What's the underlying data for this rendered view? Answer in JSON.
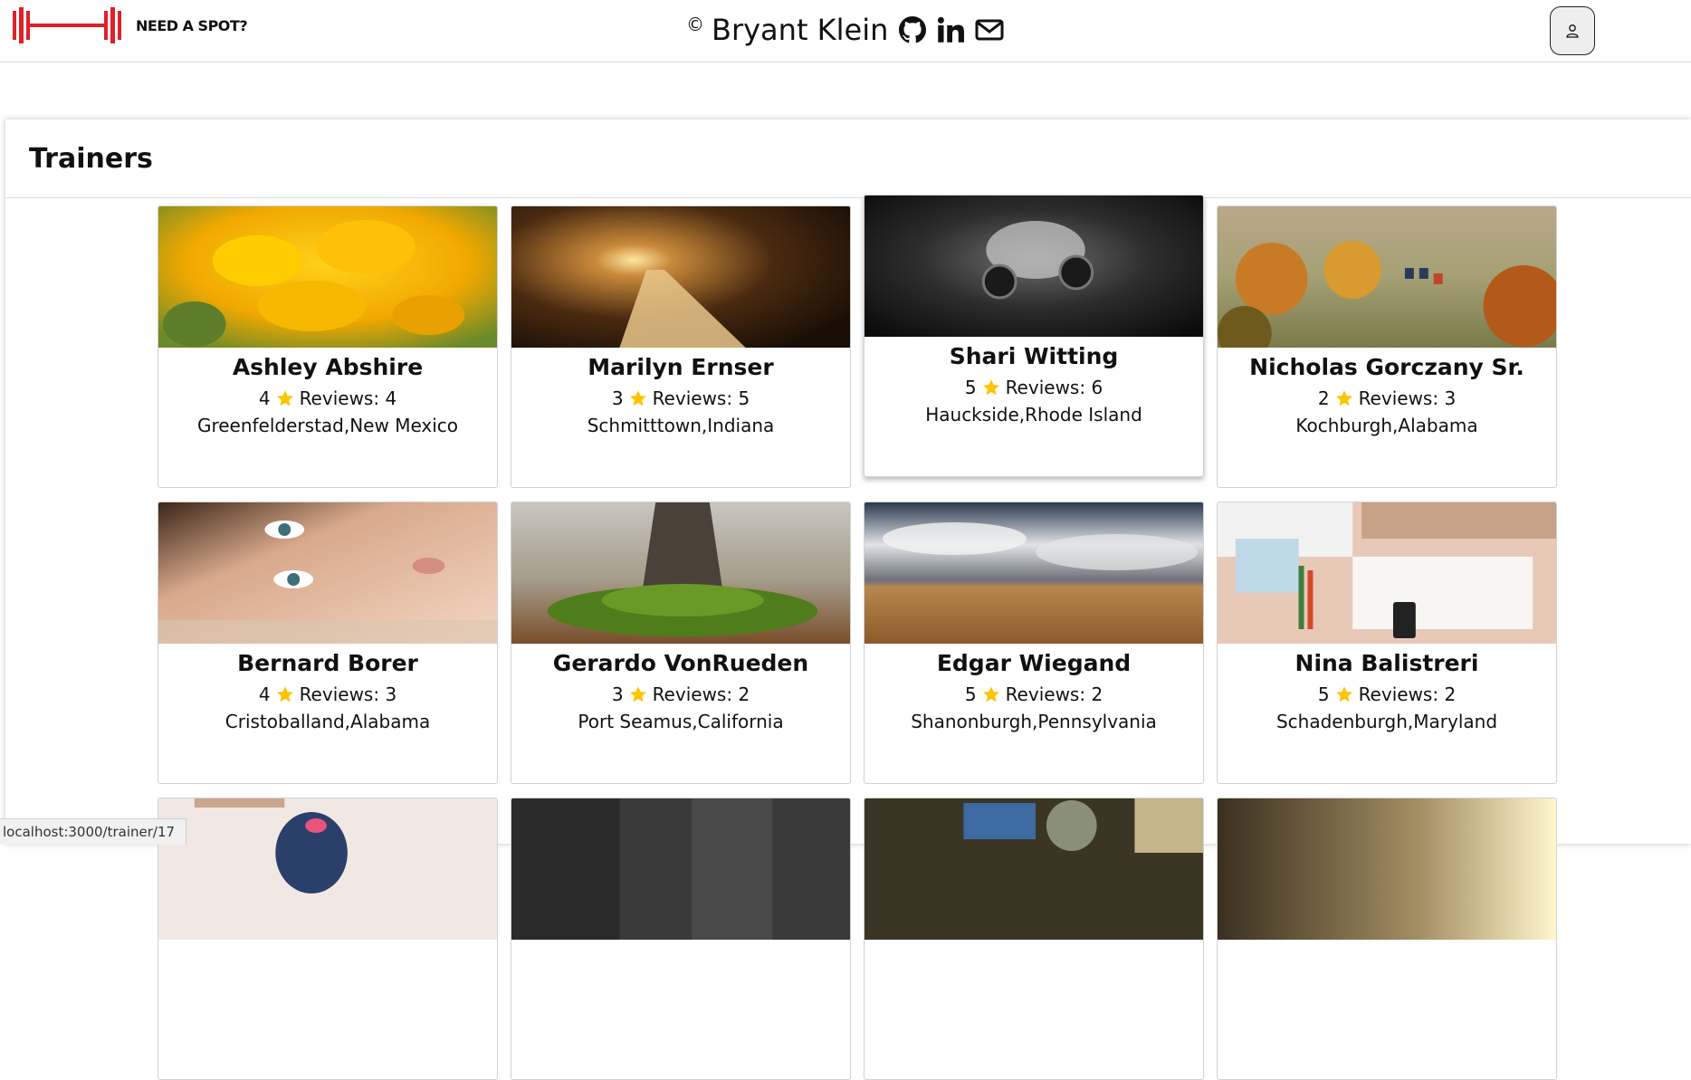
{
  "header": {
    "logo_text": "NEED A SPOT?",
    "copyright_symbol": "©",
    "author": "Bryant Klein",
    "icons": [
      "github-icon",
      "linkedin-icon",
      "mail-icon"
    ],
    "user_icon": "user-icon"
  },
  "page": {
    "title": "Trainers"
  },
  "reviews_label": "Reviews:",
  "trainers": [
    {
      "name": "Ashley Abshire",
      "rating": "4",
      "reviews": "4",
      "location": "Greenfelderstad,New Mexico"
    },
    {
      "name": "Marilyn Ernser",
      "rating": "3",
      "reviews": "5",
      "location": "Schmitttown,Indiana"
    },
    {
      "name": "Shari Witting",
      "rating": "5",
      "reviews": "6",
      "location": "Hauckside,Rhode Island"
    },
    {
      "name": "Nicholas Gorczany Sr.",
      "rating": "2",
      "reviews": "3",
      "location": "Kochburgh,Alabama"
    },
    {
      "name": "Bernard Borer",
      "rating": "4",
      "reviews": "3",
      "location": "Cristoballand,Alabama"
    },
    {
      "name": "Gerardo VonRueden",
      "rating": "3",
      "reviews": "2",
      "location": "Port Seamus,California"
    },
    {
      "name": "Edgar Wiegand",
      "rating": "5",
      "reviews": "2",
      "location": "Shanonburgh,Pennsylvania"
    },
    {
      "name": "Nina Balistreri",
      "rating": "5",
      "reviews": "2",
      "location": "Schadenburgh,Maryland"
    }
  ],
  "status_bar": {
    "url": "localhost:3000/trainer/17"
  },
  "colors": {
    "logo_red": "#e0202a",
    "star": "#ffc400"
  }
}
